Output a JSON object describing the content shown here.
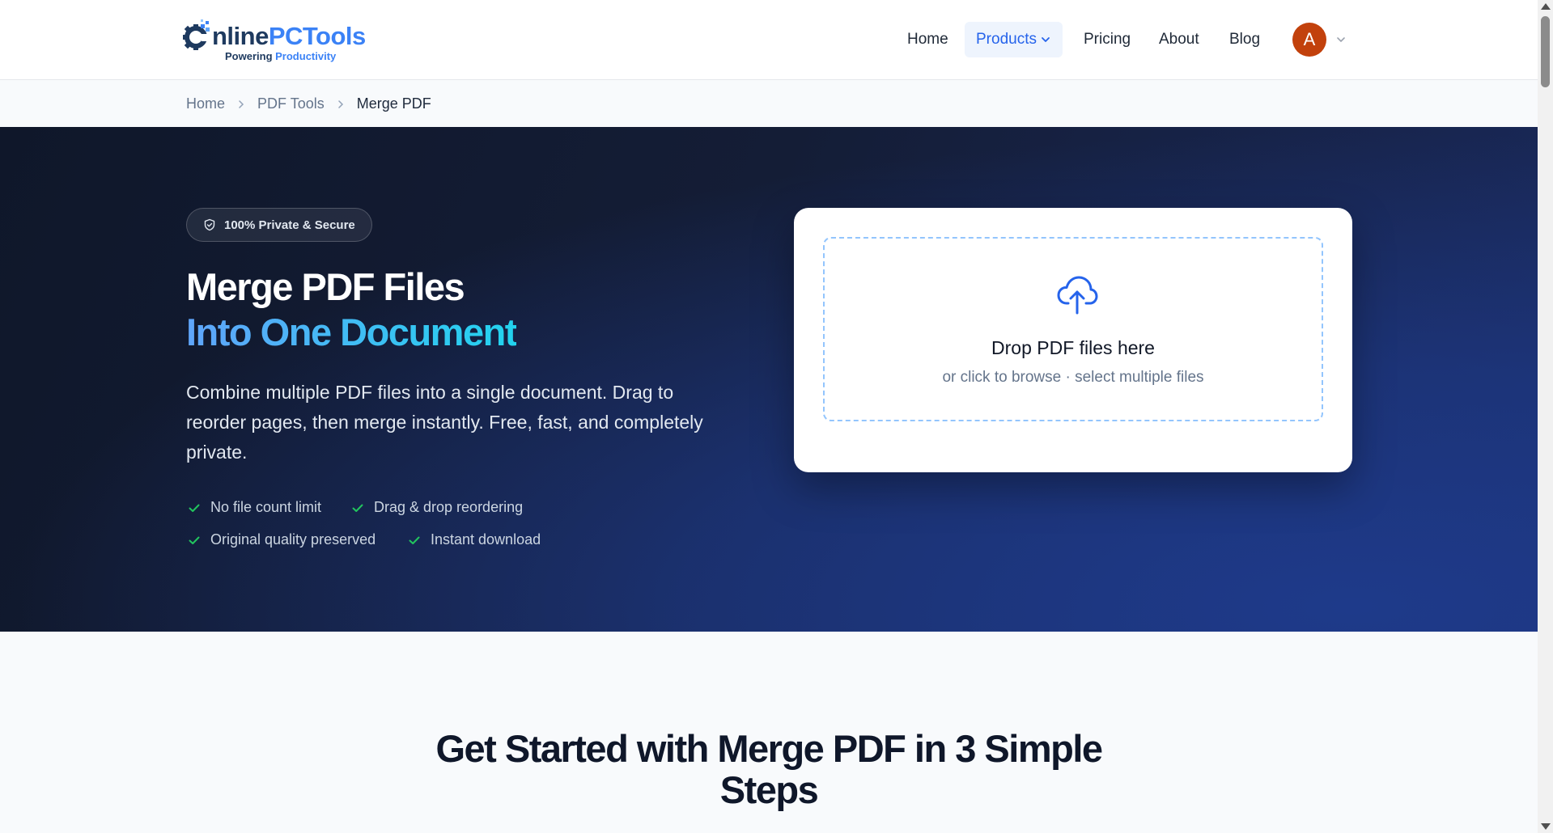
{
  "brand": {
    "logo_prefix": "nline",
    "logo_accent": "PCTools",
    "tagline_dark": "Powering",
    "tagline_accent": "Productivity"
  },
  "nav": {
    "home": "Home",
    "products": "Products",
    "pricing": "Pricing",
    "about": "About",
    "blog": "Blog",
    "avatar_initial": "A"
  },
  "breadcrumb": {
    "home": "Home",
    "pdf_tools": "PDF Tools",
    "current": "Merge PDF"
  },
  "hero": {
    "badge": "100% Private & Secure",
    "title_line1": "Merge PDF Files",
    "title_line2": "Into One Document",
    "description": "Combine multiple PDF files into a single document. Drag to reorder pages, then merge instantly. Free, fast, and completely private.",
    "features": [
      "No file count limit",
      "Drag & drop reordering",
      "Original quality preserved",
      "Instant download"
    ]
  },
  "upload": {
    "title": "Drop PDF files here",
    "subtitle": "or click to browse · select multiple files"
  },
  "steps": {
    "title": "Get Started with Merge PDF in 3 Simple Steps"
  },
  "colors": {
    "accent": "#2563eb",
    "hero_dark": "#0f172a",
    "hero_blue": "#1e3a8a",
    "check_green": "#22c55e",
    "avatar": "#c2410c"
  },
  "icons": {
    "logo": "gear-icon",
    "badge": "shield-icon",
    "feature": "check-icon",
    "upload": "cloud-upload-icon"
  }
}
